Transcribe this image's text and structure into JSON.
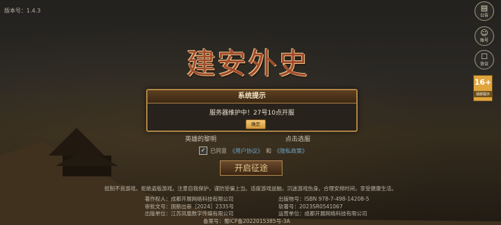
{
  "version": "版本号：1.4.3",
  "side_buttons": {
    "notice": "公告",
    "account": "账号",
    "agreement": "协议"
  },
  "age_badge": {
    "rating": "16+",
    "tip": "适龄提示"
  },
  "logo_text": "建安外史",
  "menu": {
    "left": "英雄的黎明",
    "right": "点击选服"
  },
  "agreement": {
    "checked": true,
    "prefix": "已同意",
    "link1": "《用户协议》",
    "and": "和",
    "link2": "《隐私政策》"
  },
  "start_button": "开启征途",
  "health_notice": "抵制不良游戏，拒绝盗版游戏。注意自我保护，谨防受骗上当。适度游戏益脑，沉迷游戏伤身。合理安排时间，享受健康生活。",
  "credits": [
    [
      "著作权人：成都开展网络科技有限公司",
      "出版物号：ISBN 978-7-498-14208-5"
    ],
    [
      "审批文号：国新出审［2024］2335号",
      "软著号：2023SR0541067"
    ],
    [
      "出版单位：江苏凤凰数字传媒有限公司",
      "运营单位：成都开展网络科技有限公司"
    ],
    [
      "备案号：蜀ICP备2022015385号-3A",
      ""
    ]
  ],
  "dialog": {
    "title": "系统提示",
    "message": "服务器维护中！27号10点开服",
    "ok": "确定"
  }
}
